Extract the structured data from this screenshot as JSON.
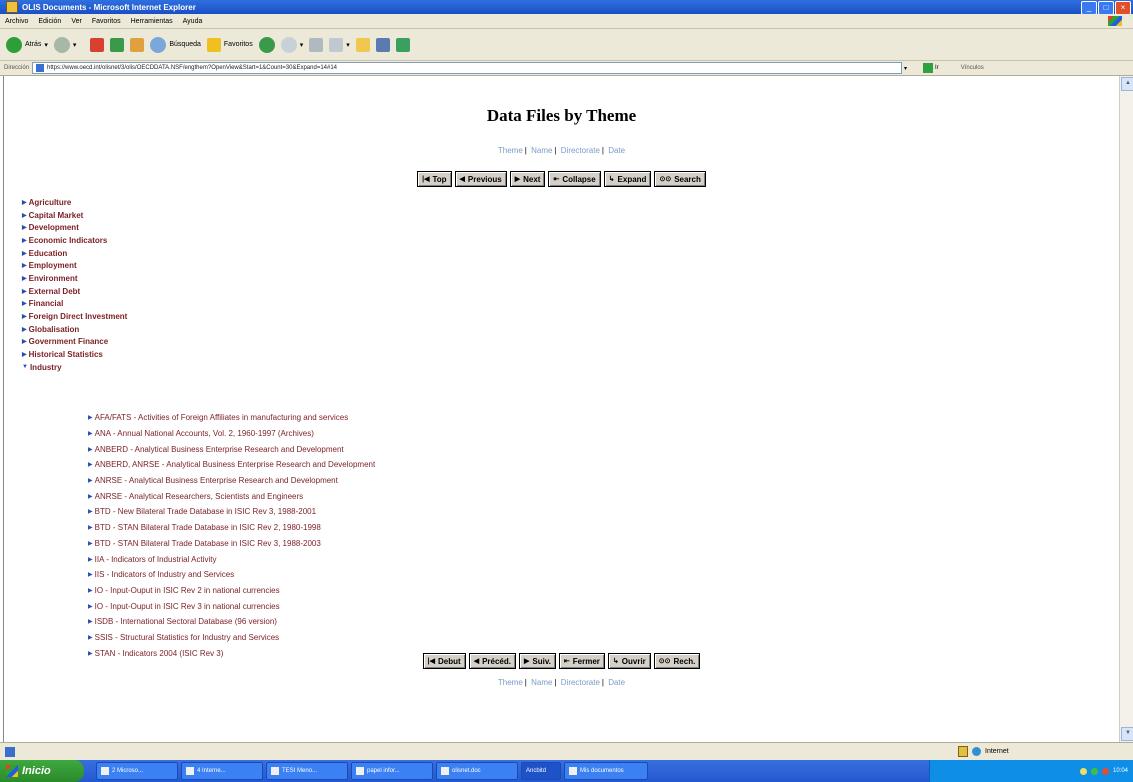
{
  "window": {
    "title": "OLIS Documents - Microsoft Internet Explorer"
  },
  "menu": [
    "Archivo",
    "Edición",
    "Ver",
    "Favoritos",
    "Herramientas",
    "Ayuda"
  ],
  "toolbar": {
    "back": "Atrás",
    "search": "Búsqueda",
    "favorites": "Favoritos"
  },
  "address": {
    "label": "Dirección",
    "url": "https://www.oecd.int/olisnet/3/olis/OECDDATA.NSF/engthem?OpenView&Start=1&Count=30&Expand=14#14",
    "go": "Ir",
    "links": "Vínculos"
  },
  "page": {
    "heading": "Data Files by Theme",
    "navlinks": [
      "Theme",
      "Name",
      "Directorate",
      "Date"
    ],
    "nav_top": [
      "Top",
      "Previous",
      "Next",
      "Collapse",
      "Expand",
      "Search"
    ],
    "nav_bottom": [
      "Debut",
      "Précéd.",
      "Suiv.",
      "Fermer",
      "Ouvrir",
      "Rech."
    ],
    "themes": [
      "Agriculture",
      "Capital Market",
      "Development",
      "Economic Indicators",
      "Education",
      "Employment",
      "Environment",
      "External Debt",
      "Financial",
      "Foreign Direct Investment",
      "Globalisation",
      "Government Finance",
      "Historical Statistics",
      "Industry"
    ],
    "industry_items": [
      "AFA/FATS - Activities of Foreign Affiliates in manufacturing and services",
      "ANA - Annual National Accounts, Vol. 2, 1960-1997 (Archives)",
      "ANBERD - Analytical Business Enterprise Research and Development",
      "ANBERD, ANRSE - Analytical Business Enterprise Research and Development",
      "ANRSE - Analytical Business Enterprise Research and Development",
      "ANRSE - Analytical Researchers, Scientists and Engineers",
      "BTD - New Bilateral Trade Database in ISIC Rev 3, 1988-2001",
      "BTD - STAN Bilateral Trade Database in ISIC Rev 2, 1980-1998",
      "BTD - STAN Bilateral Trade Database in ISIC Rev 3, 1988-2003",
      "IIA - Indicators of Industrial Activity",
      "IIS - Indicators of Industry and Services",
      "IO - Input-Ouput in ISIC Rev 2 in national currencies",
      "IO - Input-Ouput in ISIC Rev 3 in national currencies",
      "ISDB - International Sectoral Database (96 version)",
      "SSIS - Structural Statistics for Industry and Services",
      "STAN - Indicators 2004 (ISIC Rev 3)"
    ]
  },
  "status": {
    "zone": "Internet"
  },
  "taskbar": {
    "start": "Inicio",
    "tasks": [
      "2 Microso...",
      "4 Interne...",
      "TESI Meno...",
      "papel infor...",
      "olisnet.doc",
      "Ancbitd",
      "Mis documentos"
    ],
    "clock": "10:04"
  }
}
